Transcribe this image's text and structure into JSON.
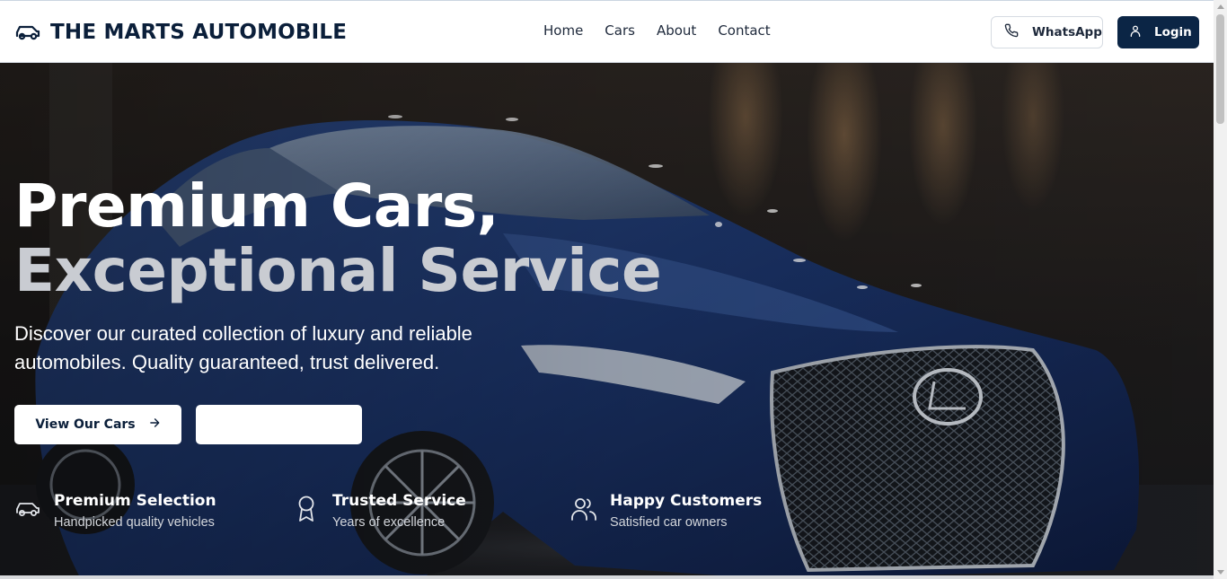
{
  "brand": {
    "name": "THE MARTS AUTOMOBILE",
    "icon": "car-icon"
  },
  "nav": {
    "items": [
      "Home",
      "Cars",
      "About",
      "Contact"
    ]
  },
  "actions": {
    "whatsapp": {
      "label": "WhatsApp",
      "icon": "phone-icon"
    },
    "login": {
      "label": "Login",
      "icon": "user-icon"
    }
  },
  "hero": {
    "title_line1": "Premium Cars,",
    "title_line2": "Exceptional Service",
    "subtitle": "Discover our curated collection of luxury and reliable automobiles. Quality guaranteed, trust delivered.",
    "primary_button": {
      "label": "View Our Cars",
      "icon": "arrow-right-icon"
    },
    "secondary_button": {
      "label": ""
    },
    "background": "luxury blue car in showroom"
  },
  "features": [
    {
      "icon": "car-icon",
      "title": "Premium Selection",
      "subtitle": "Handpicked quality vehicles"
    },
    {
      "icon": "award-icon",
      "title": "Trusted Service",
      "subtitle": "Years of excellence"
    },
    {
      "icon": "users-icon",
      "title": "Happy Customers",
      "subtitle": "Satisfied car owners"
    }
  ],
  "colors": {
    "primary": "#0b2545",
    "brand_text": "#0b1f3a",
    "secondary_title": "#c9ccd2"
  }
}
